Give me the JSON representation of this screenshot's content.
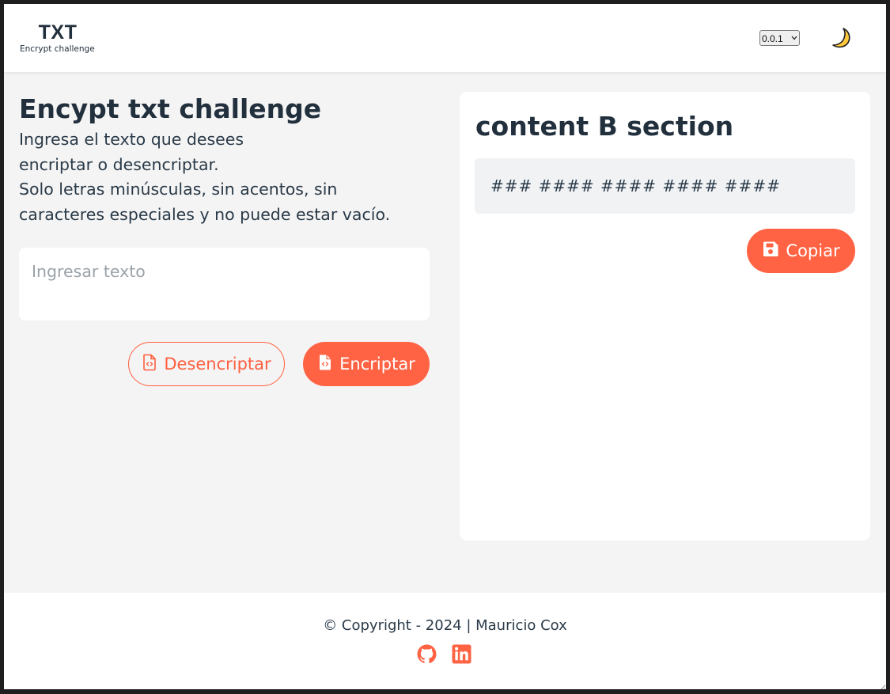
{
  "header": {
    "logo_title": "TXT",
    "logo_subtitle": "Encrypt challenge",
    "version_selected": "0.0.1",
    "theme_icon": "moon-icon"
  },
  "left": {
    "title": "Encypt txt challenge",
    "instructions": [
      "Ingresa el texto que desees",
      "encriptar o desencriptar.",
      "Solo letras minúsculas, sin acentos, sin",
      "caracteres especiales y no puede estar vacío."
    ],
    "input_placeholder": "Ingresar texto",
    "decrypt_label": "Desencriptar",
    "encrypt_label": "Encriptar"
  },
  "card": {
    "title": "content B section",
    "output_text": "### #### #### #### ####",
    "copy_label": "Copiar"
  },
  "footer": {
    "copyright": "© Copyright - 2024 | Mauricio Cox",
    "links": [
      "github-icon",
      "linkedin-icon"
    ]
  },
  "colors": {
    "accent": "#ff6344",
    "text": "#22303d",
    "background": "#f4f4f4"
  }
}
